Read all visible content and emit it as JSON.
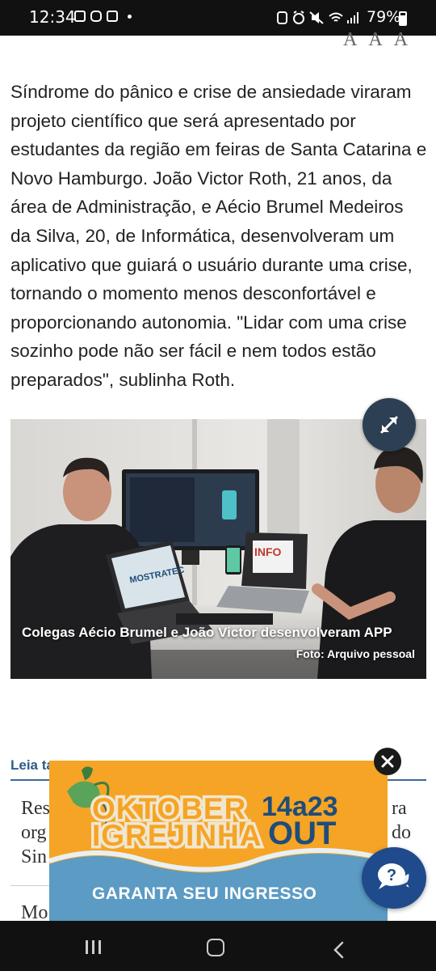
{
  "status_bar": {
    "time": "12:34",
    "battery": "79%"
  },
  "font_controls": [
    "A",
    "A",
    "A"
  ],
  "article": {
    "paragraph": "Síndrome do pânico e crise de ansiedade viraram projeto científico que será apresentado por estudantes da região em feiras de Santa Catarina e Novo Hamburgo. João Victor Roth, 21 anos, da área de Administração, e Aécio Brumel Medeiros da Silva, 20, de Informática, desenvolveram um aplicativo que guiará o usuário durante uma crise, tornando o momento menos desconfortável e proporcionando autonomia. \"Lidar com uma crise sozinho pode não ser fácil e nem todos estão preparados\", sublinha Roth."
  },
  "photo": {
    "caption": "Colegas Aécio Brumel e João Victor desenvolveram APP",
    "credit": "Foto: Arquivo pessoal",
    "laptop_left_text": "MOSTRATEC",
    "laptop_right_text": "INFO"
  },
  "read_also": {
    "label": "Leia ta",
    "item1_left": [
      "Res",
      "org",
      "Sin"
    ],
    "item1_right": [
      "ra",
      "do"
    ],
    "item2_left": "Mo"
  },
  "ad": {
    "line1": "OKTOBER",
    "line2": "IGREJINHA",
    "date": "14a23",
    "month": "OUT",
    "cta": "GARANTA SEU INGRESSO",
    "colors": {
      "background": "#f5a425",
      "accent": "#1f4d7a",
      "wave": "#5b9bc4"
    }
  },
  "icons": {
    "expand": "expand-arrows-icon",
    "close": "close-icon",
    "chat": "help-chat-icon"
  }
}
